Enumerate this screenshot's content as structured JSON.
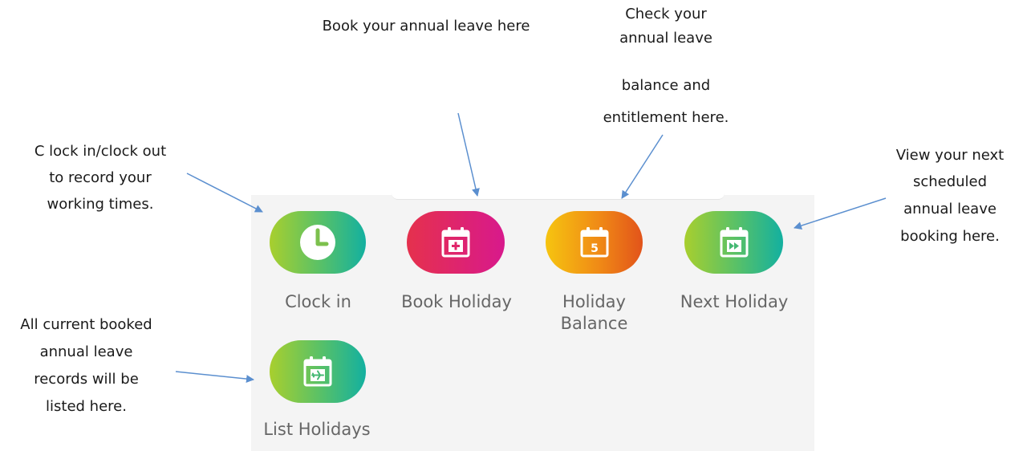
{
  "annotations": {
    "book_holiday": "Book your annual leave here",
    "balance_line1": "Check your",
    "balance_line2": "annual leave",
    "balance_line3": "balance and",
    "balance_line4": "entitlement here.",
    "clock_line1": "C lock in/clock out",
    "clock_line2": "to record your",
    "clock_line3": "working times.",
    "next_line1": "View your next",
    "next_line2": "scheduled",
    "next_line3": "annual leave",
    "next_line4": "booking here.",
    "list_line1": "All current booked",
    "list_line2": "annual leave",
    "list_line3": "records will be",
    "list_line4": "listed here."
  },
  "tiles": {
    "clock_in": {
      "label": "Clock in",
      "icon": "clock-icon"
    },
    "book_holiday": {
      "label": "Book Holiday",
      "icon": "calendar-plus-icon"
    },
    "holiday_balance": {
      "label_line1": "Holiday",
      "label_line2": "Balance",
      "icon": "calendar-number-icon",
      "icon_number": "5"
    },
    "next_holiday": {
      "label": "Next Holiday",
      "icon": "calendar-forward-icon"
    },
    "list_holidays": {
      "label": "List Holidays",
      "icon": "calendar-plane-icon"
    }
  },
  "colors": {
    "green_gradient": [
      "#a8cf2e",
      "#13b0a0"
    ],
    "pink_gradient": [
      "#e5314d",
      "#d8198c"
    ],
    "orange_gradient": [
      "#f6c410",
      "#e2531a"
    ],
    "arrow": "#5b8fcf",
    "label_text": "#666666",
    "panel_background": "#f4f4f4"
  }
}
